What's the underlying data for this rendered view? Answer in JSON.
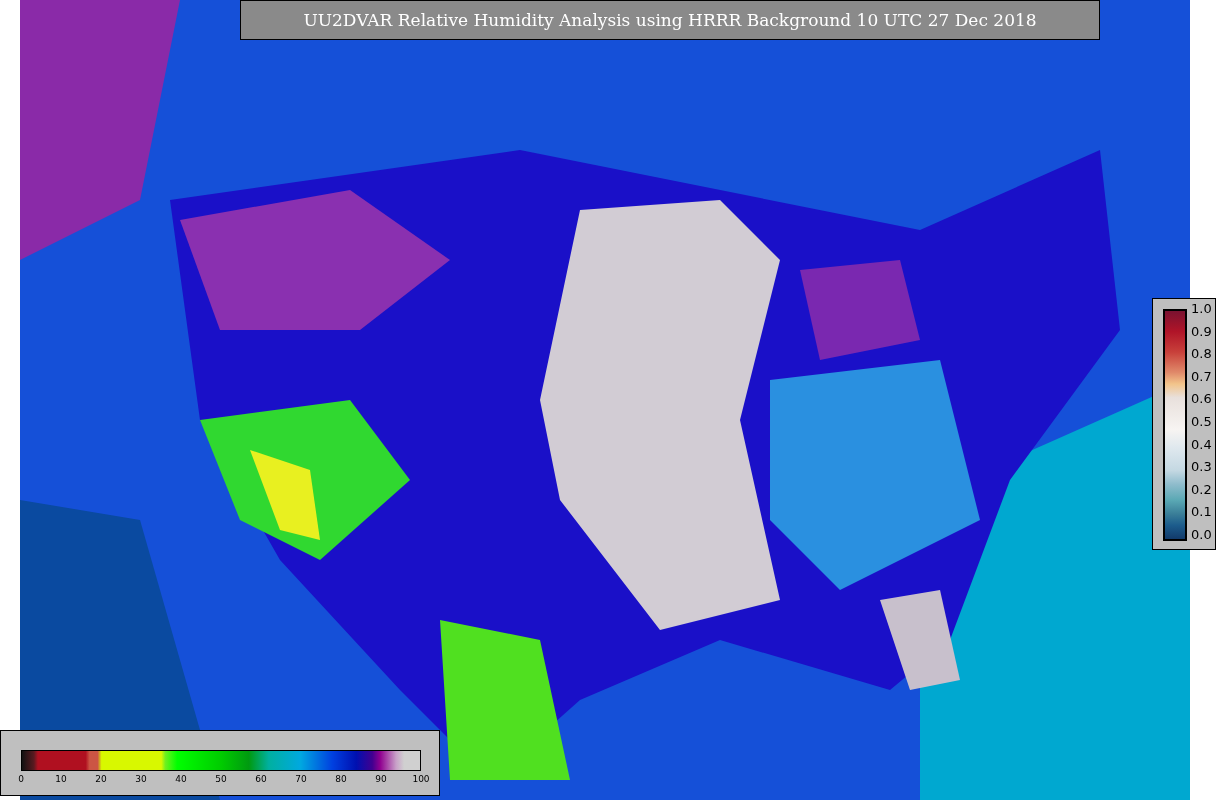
{
  "title": "UU2DVAR Relative Humidity Analysis using HRRR Background 10 UTC 27 Dec 2018",
  "station_colorbar": {
    "ticks": [
      "1.0",
      "0.9",
      "0.8",
      "0.7",
      "0.6",
      "0.5",
      "0.4",
      "0.3",
      "0.2",
      "0.1",
      "0.0"
    ]
  },
  "humidity_colorbar": {
    "ticks": [
      "0",
      "10",
      "20",
      "30",
      "40",
      "50",
      "60",
      "70",
      "80",
      "90",
      "100"
    ]
  }
}
